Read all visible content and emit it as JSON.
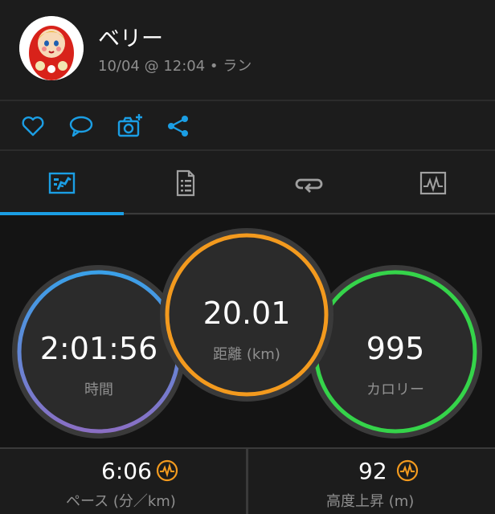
{
  "header": {
    "user_name": "ベリー",
    "activity_meta": "10/04 @ 12:04 • ラン"
  },
  "social": {
    "items": [
      {
        "name": "like",
        "icon": "heart-icon"
      },
      {
        "name": "comment",
        "icon": "comment-icon"
      },
      {
        "name": "add-photo",
        "icon": "camera-plus-icon"
      },
      {
        "name": "share",
        "icon": "share-icon"
      }
    ]
  },
  "tabs": {
    "items": [
      {
        "icon": "run-summary-icon",
        "selected": true
      },
      {
        "icon": "details-document-icon",
        "selected": false
      },
      {
        "icon": "laps-loop-icon",
        "selected": false
      },
      {
        "icon": "chart-pulse-icon",
        "selected": false
      }
    ]
  },
  "stats": {
    "time": {
      "value": "2:01:56",
      "label": "時間"
    },
    "distance": {
      "value": "20.01",
      "label": "距離 (km)"
    },
    "calories": {
      "value": "995",
      "label": "カロリー"
    }
  },
  "metrics": {
    "pace": {
      "value": "6:06",
      "label": "ペース (分／km)",
      "icon": "insight-wave-icon"
    },
    "elevation": {
      "value": "92",
      "label": "高度上昇 (m)",
      "icon": "insight-wave-icon"
    }
  },
  "colors": {
    "accent_blue": "#1b9ee4",
    "distance_ring": "#f39a1e",
    "calories_ring": "#35d44a",
    "time_ring_start": "#3aa0e8",
    "time_ring_end": "#8a6fc4",
    "insight_orange": "#f39a1e"
  }
}
